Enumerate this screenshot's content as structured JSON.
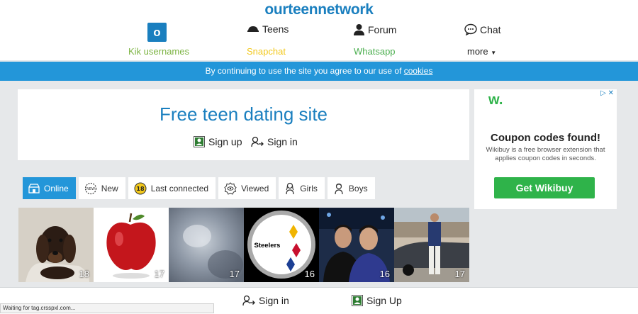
{
  "brand": "ourteennetwork",
  "nav": {
    "kik_letter": "o",
    "teens": "Teens",
    "forum": "Forum",
    "chat": "Chat",
    "kik_usernames": "Kik usernames",
    "snapchat": "Snapchat",
    "whatsapp": "Whatsapp",
    "more": "more"
  },
  "cookie": {
    "text": "By continuing to use the site you agree to our use of",
    "link": "cookies"
  },
  "hero": {
    "title": "Free teen dating site",
    "signup": "Sign up",
    "signin": "Sign in"
  },
  "ad": {
    "logo": "w.",
    "headline": "Coupon codes found!",
    "body": "Wikibuy is a free browser extension that applies coupon codes in seconds.",
    "cta": "Get Wikibuy"
  },
  "tabs": [
    {
      "label": "Online",
      "icon": "store-icon"
    },
    {
      "label": "New",
      "icon": "new-badge-icon"
    },
    {
      "label": "Last connected",
      "icon": "18-badge-icon"
    },
    {
      "label": "Viewed",
      "icon": "eye-badge-icon"
    },
    {
      "label": "Girls",
      "icon": "girl-icon"
    },
    {
      "label": "Boys",
      "icon": "boy-icon"
    }
  ],
  "profiles": [
    {
      "age": "18",
      "image": "dachshund-dog"
    },
    {
      "age": "17",
      "image": "red-apple"
    },
    {
      "age": "17",
      "image": "blurred-gray"
    },
    {
      "age": "16",
      "image": "steelers-logo"
    },
    {
      "age": "16",
      "image": "two-young-men"
    },
    {
      "age": "17",
      "image": "man-by-car"
    }
  ],
  "steelers_text": "Steelers",
  "footer": {
    "signin": "Sign in",
    "signup": "Sign Up"
  },
  "status": "Waiting for tag.crsspxl.com...",
  "colors": {
    "brand_blue": "#1a7fbf",
    "cookie_bar": "#2396d9",
    "kik_green": "#7cb342",
    "snapchat_yellow": "#f2c81c",
    "whatsapp_green": "#4caf50",
    "ad_green": "#2fb34a"
  }
}
